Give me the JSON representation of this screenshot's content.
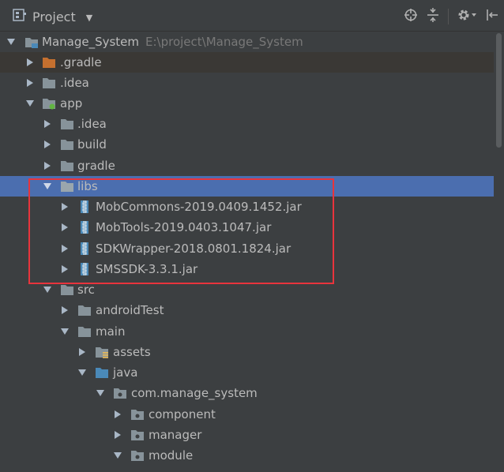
{
  "toolbar": {
    "title": "Project",
    "view_icon": "project-view-icon",
    "actions": [
      "locate-icon",
      "collapse-all-icon",
      "settings-icon",
      "hide-panel-icon"
    ]
  },
  "tree": {
    "root": {
      "label": "Manage_System",
      "path": "E:\\project\\Manage_System"
    },
    "gradle_dir": ".gradle",
    "idea_dir": ".idea",
    "app": {
      "label": "app",
      "idea": ".idea",
      "build": "build",
      "gradle": "gradle",
      "libs": {
        "label": "libs",
        "jars": [
          "MobCommons-2019.0409.1452.jar",
          "MobTools-2019.0403.1047.jar",
          "SDKWrapper-2018.0801.1824.jar",
          "SMSSDK-3.3.1.jar"
        ]
      },
      "src": {
        "label": "src",
        "android_test": "androidTest",
        "main": "main",
        "assets": "assets",
        "java": "java",
        "package": "com.manage_system",
        "subpackages": [
          "component",
          "manager",
          "module"
        ]
      }
    }
  },
  "colors": {
    "background": "#3c3f41",
    "selection": "#4b6eaf",
    "folder": "#87939a",
    "gradle_folder": "#c5702f",
    "source_folder": "#4a89b8",
    "highlight_box": "#e8343c"
  }
}
